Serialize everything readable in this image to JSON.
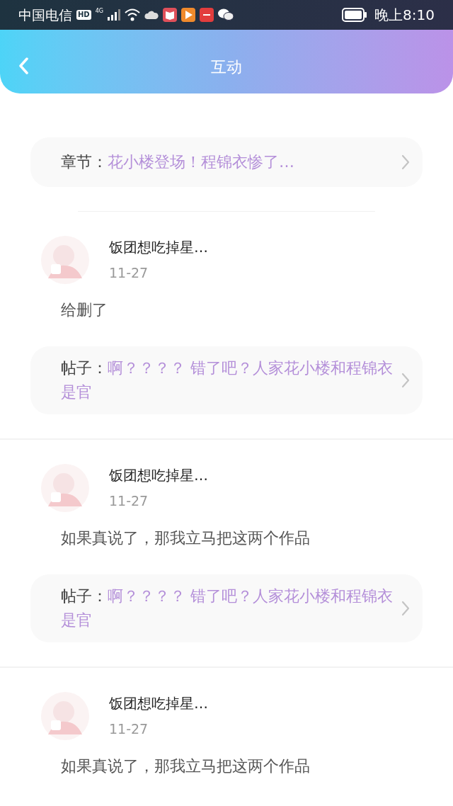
{
  "status_bar": {
    "carrier": "中国电信",
    "hd_badge": "HD",
    "network": "4G",
    "time": "晚上8:10"
  },
  "header": {
    "title": "互动"
  },
  "partial_item": {
    "reference": {
      "label": "章节：",
      "text": "花小楼登场！程锦衣惨了…"
    }
  },
  "comments": [
    {
      "user": "饭团想吃掉星…",
      "date": "11-27",
      "text": "给删了",
      "reference": {
        "label": "帖子：",
        "text": "啊？？？？ 错了吧？人家花小楼和程锦衣是官"
      }
    },
    {
      "user": "饭团想吃掉星…",
      "date": "11-27",
      "text": "如果真说了，那我立马把这两个作品",
      "reference": {
        "label": "帖子：",
        "text": "啊？？？？ 错了吧？人家花小楼和程锦衣是官"
      }
    },
    {
      "user": "饭团想吃掉星…",
      "date": "11-27",
      "text": "如果真说了，那我立马把这两个作品"
    }
  ]
}
